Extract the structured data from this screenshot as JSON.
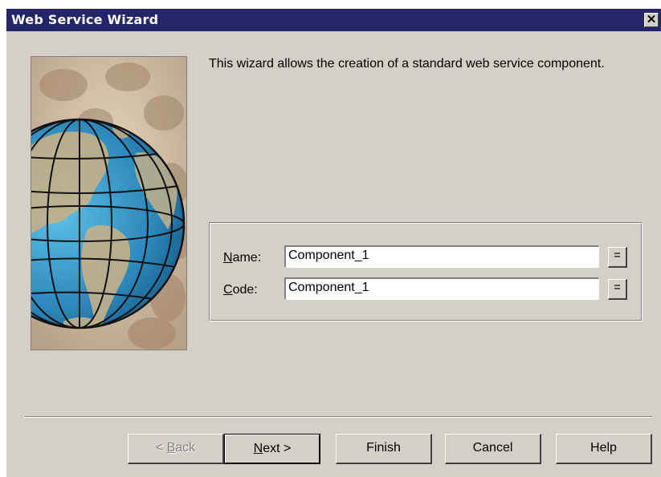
{
  "window": {
    "title": "Web Service Wizard",
    "close_glyph": "✕"
  },
  "art": {
    "icon": "globe-illustration"
  },
  "intro": "This wizard allows the creation of a standard web service component.",
  "form": {
    "name_label_accel": "N",
    "name_label_rest": "ame:",
    "name_value": "Component_1",
    "code_label_accel": "C",
    "code_label_rest": "ode:",
    "code_value": "Component_1",
    "eq_label": "="
  },
  "buttons": {
    "back_prefix": "< ",
    "back_accel": "B",
    "back_rest": "ack",
    "next_accel": "N",
    "next_rest": "ext >",
    "finish": "Finish",
    "cancel": "Cancel",
    "help": "Help"
  },
  "colors": {
    "titlebar": "#24246b",
    "dialog": "#d4d0c8",
    "ocean": "#2f8fc2",
    "land": "#c2b08a"
  }
}
